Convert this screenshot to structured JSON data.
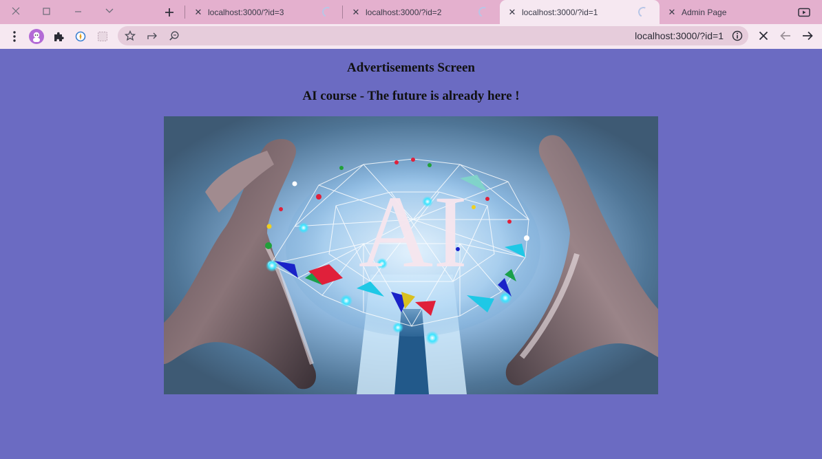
{
  "browser": {
    "tabs": [
      {
        "title": "localhost:3000/?id=3",
        "active": false,
        "loading": true
      },
      {
        "title": "localhost:3000/?id=2",
        "active": false,
        "loading": true
      },
      {
        "title": "localhost:3000/?id=1",
        "active": true,
        "loading": true
      },
      {
        "title": "Admin Page",
        "active": false,
        "loading": false
      }
    ],
    "address_bar": {
      "url": "localhost:3000/?id=1"
    }
  },
  "page": {
    "heading": "Advertisements Screen",
    "ad_title": "AI course - The future is already here !",
    "ad_image_text": "AI",
    "background_color": "#6b6bc2"
  }
}
